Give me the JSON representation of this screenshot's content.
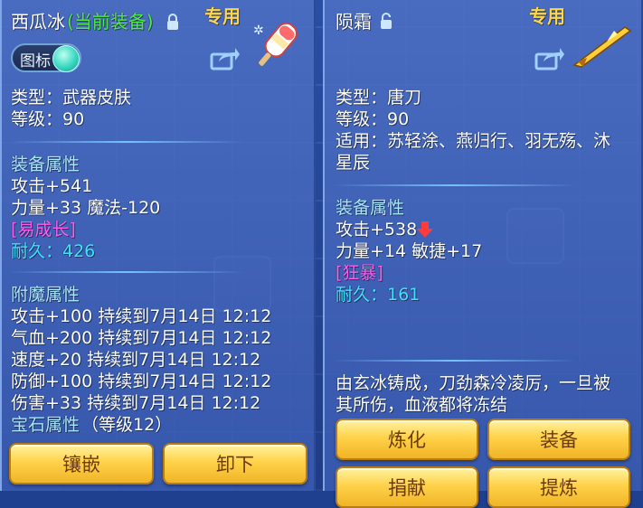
{
  "left": {
    "name": "西瓜冰",
    "equipped": "(当前装备)",
    "exclusive": "专用",
    "toggle_label": "图标",
    "type": "类型：武器皮肤",
    "level": "等级：90",
    "attr_header": "装备属性",
    "attr_lines": [
      "攻击+541",
      "力量+33 魔法-120"
    ],
    "growth_tag": "[易成长]",
    "durability": "耐久：426",
    "enchant_header": "附魔属性",
    "enchant_lines": [
      "攻击+100 持续到7月14日 12:12",
      "气血+200 持续到7月14日 12:12",
      "速度+20 持续到7月14日 12:12",
      "防御+100 持续到7月14日 12:12",
      "伤害+33 持续到7月14日 12:12"
    ],
    "gem_header": "宝石属性",
    "gem_level": "（等级12）",
    "buttons": {
      "inlay": "镶嵌",
      "unequip": "卸下"
    }
  },
  "right": {
    "name": "陨霜",
    "exclusive": "专用",
    "type": "类型：唐刀",
    "level": "等级：90",
    "usable_line1": "适用：苏轻涂、燕归行、羽无殇、沐",
    "usable_line2": "星辰",
    "attr_header": "装备属性",
    "attack": "攻击+538",
    "attr_line2": "力量+14 敏捷+17",
    "rage_tag": "[狂暴]",
    "durability": "耐久：161",
    "desc_line1": "由玄冰铸成，刀劲森冷凌厉，一旦被",
    "desc_line2": "其所伤，血液都将冻结",
    "buttons": {
      "refine": "炼化",
      "equip": "装备",
      "donate": "捐献",
      "forge": "提炼"
    }
  },
  "colors": {
    "accent_gold": "#ffd64a",
    "section_blue": "#a9e6ff",
    "tag_purple": "#ff5cf0",
    "durability_cyan": "#3fe3ff",
    "equipped_green": "#52e84a"
  }
}
